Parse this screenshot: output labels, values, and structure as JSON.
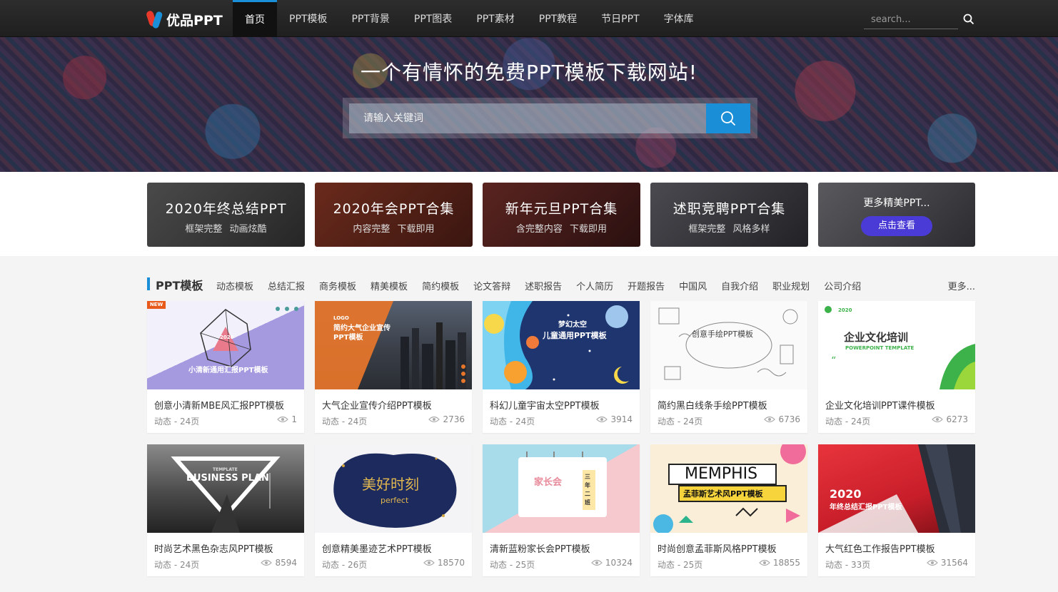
{
  "header": {
    "logo_text": "优品PPT",
    "nav": [
      "首页",
      "PPT模板",
      "PPT背景",
      "PPT图表",
      "PPT素材",
      "PPT教程",
      "节日PPT",
      "字体库"
    ],
    "search_placeholder": "search..."
  },
  "hero": {
    "title": "一个有情怀的免费PPT模板下载网站!",
    "search_placeholder": "请输入关键词"
  },
  "banners": [
    {
      "title": "2020年终总结PPT",
      "sub": "框架完整  动画炫酷",
      "bg": "#3a3a3a"
    },
    {
      "title": "2020年会PPT合集",
      "sub": "内容完整  下载即用",
      "bg": "#4a2218"
    },
    {
      "title": "新年元旦PPT合集",
      "sub": "含完整内容  下载即用",
      "bg": "#3a1a18"
    },
    {
      "title": "述职竞聘PPT合集",
      "sub": "框架完整  风格多样",
      "bg": "#2f2f33"
    },
    {
      "title": "更多精美PPT...",
      "button": "点击查看",
      "bg": "#3e3e42"
    }
  ],
  "category": {
    "title": "PPT模板",
    "tabs": [
      "动态模板",
      "总结汇报",
      "商务模板",
      "精美模板",
      "简约模板",
      "论文答辩",
      "述职报告",
      "个人简历",
      "开题报告",
      "中国风",
      "自我介绍",
      "职业规划",
      "公司介绍"
    ],
    "more": "更多..."
  },
  "cards": [
    {
      "title": "创意小清新MBE风汇报PPT模板",
      "meta": "动态 - 24页",
      "views": "1",
      "badge": "NEW",
      "thumb_text": "小清新通用汇报PPT模板",
      "thumb_sub": "2020"
    },
    {
      "title": "大气企业宣传介绍PPT模板",
      "meta": "动态 - 24页",
      "views": "2736",
      "thumb_text": "简约大气企业宣传PPT模板",
      "thumb_sub": "LOGO"
    },
    {
      "title": "科幻儿童宇宙太空PPT模板",
      "meta": "动态 - 24页",
      "views": "3914",
      "thumb_text": "儿童通用PPT模板",
      "thumb_sub": "梦幻太空"
    },
    {
      "title": "简约黑白线条手绘PPT模板",
      "meta": "动态 - 24页",
      "views": "6736",
      "thumb_text": "创意手绘PPT模板"
    },
    {
      "title": "企业文化培训PPT课件模板",
      "meta": "动态 - 24页",
      "views": "6273",
      "thumb_text": "企业文化培训",
      "thumb_sub": "POWERPOINT TEMPLATE",
      "thumb_year": "2020"
    },
    {
      "title": "时尚艺术黑色杂志风PPT模板",
      "meta": "动态 - 24页",
      "views": "8594",
      "thumb_text": "BUSINESS PLAN",
      "thumb_sub": "TEMPLATE"
    },
    {
      "title": "创意精美墨迹艺术PPT模板",
      "meta": "动态 - 26页",
      "views": "18570",
      "thumb_text": "美好时刻",
      "thumb_sub": "perfect"
    },
    {
      "title": "清新蓝粉家长会PPT模板",
      "meta": "动态 - 25页",
      "views": "10324",
      "thumb_text": "家长会",
      "thumb_sub": "三年二班"
    },
    {
      "title": "时尚创意孟菲斯风格PPT模板",
      "meta": "动态 - 25页",
      "views": "18855",
      "thumb_text": "MEMPHIS",
      "thumb_sub": "孟菲斯艺术风PPT模板"
    },
    {
      "title": "大气红色工作报告PPT模板",
      "meta": "动态 - 33页",
      "views": "31564",
      "thumb_text": "2020",
      "thumb_sub": "年终总结汇报PPT模板"
    }
  ],
  "colors": {
    "accent": "#1a8fd8",
    "nav_bg": "#222222",
    "button_purple": "#4b3bd6",
    "new_badge": "#e85a1c"
  }
}
